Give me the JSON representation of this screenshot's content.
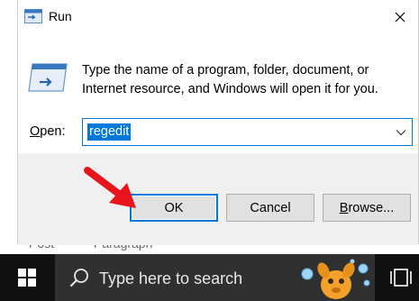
{
  "background": {
    "text1": "Post",
    "text2": "Paragraph"
  },
  "dialog": {
    "title": "Run",
    "description": "Type the name of a program, folder, document, or Internet resource, and Windows will open it for you.",
    "open_label_accel": "O",
    "open_label_rest": "pen:",
    "input_value": "regedit",
    "buttons": {
      "ok": "OK",
      "cancel": "Cancel",
      "browse_accel": "B",
      "browse_rest": "rowse..."
    }
  },
  "taskbar": {
    "search_placeholder": "Type here to search"
  },
  "colors": {
    "accent": "#0078d7",
    "arrow": "#e8141b",
    "taskbar": "#101010",
    "search_box": "#303030"
  }
}
